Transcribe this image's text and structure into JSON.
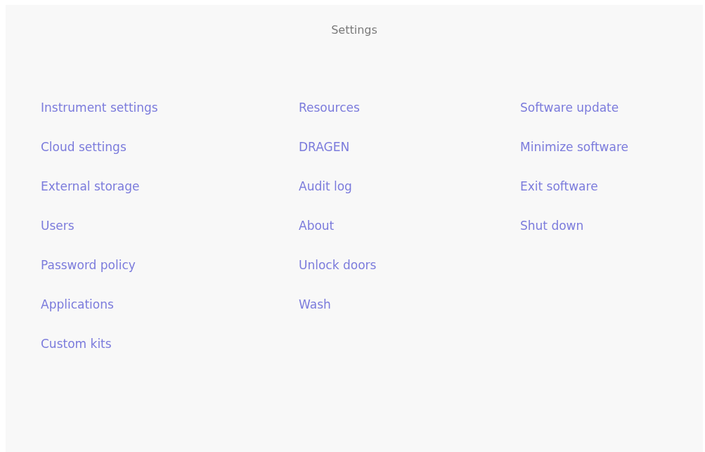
{
  "title": "Settings",
  "columns": [
    {
      "items": [
        "Instrument settings",
        "Cloud settings",
        "External storage",
        "Users",
        "Password policy",
        "Applications",
        "Custom kits"
      ]
    },
    {
      "items": [
        "Resources",
        "DRAGEN",
        "Audit log",
        "About",
        "Unlock doors",
        "Wash"
      ]
    },
    {
      "items": [
        "Software update",
        "Minimize software",
        "Exit software",
        "Shut down"
      ]
    }
  ]
}
